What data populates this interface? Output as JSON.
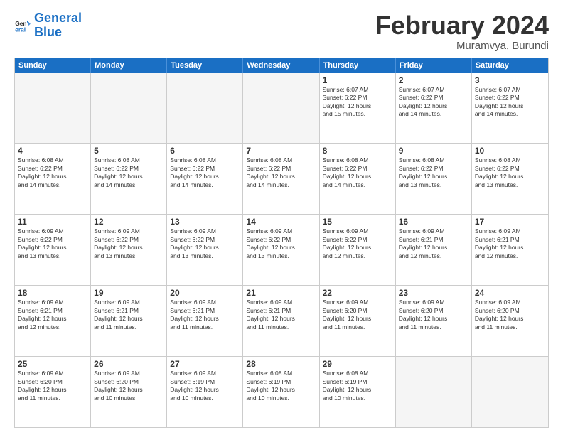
{
  "logo": {
    "line1": "General",
    "line2": "Blue"
  },
  "title": "February 2024",
  "subtitle": "Muramvya, Burundi",
  "header_days": [
    "Sunday",
    "Monday",
    "Tuesday",
    "Wednesday",
    "Thursday",
    "Friday",
    "Saturday"
  ],
  "rows": [
    [
      {
        "day": "",
        "empty": true
      },
      {
        "day": "",
        "empty": true
      },
      {
        "day": "",
        "empty": true
      },
      {
        "day": "",
        "empty": true
      },
      {
        "day": "1",
        "info": "Sunrise: 6:07 AM\nSunset: 6:22 PM\nDaylight: 12 hours\nand 15 minutes."
      },
      {
        "day": "2",
        "info": "Sunrise: 6:07 AM\nSunset: 6:22 PM\nDaylight: 12 hours\nand 14 minutes."
      },
      {
        "day": "3",
        "info": "Sunrise: 6:07 AM\nSunset: 6:22 PM\nDaylight: 12 hours\nand 14 minutes."
      }
    ],
    [
      {
        "day": "4",
        "info": "Sunrise: 6:08 AM\nSunset: 6:22 PM\nDaylight: 12 hours\nand 14 minutes."
      },
      {
        "day": "5",
        "info": "Sunrise: 6:08 AM\nSunset: 6:22 PM\nDaylight: 12 hours\nand 14 minutes."
      },
      {
        "day": "6",
        "info": "Sunrise: 6:08 AM\nSunset: 6:22 PM\nDaylight: 12 hours\nand 14 minutes."
      },
      {
        "day": "7",
        "info": "Sunrise: 6:08 AM\nSunset: 6:22 PM\nDaylight: 12 hours\nand 14 minutes."
      },
      {
        "day": "8",
        "info": "Sunrise: 6:08 AM\nSunset: 6:22 PM\nDaylight: 12 hours\nand 14 minutes."
      },
      {
        "day": "9",
        "info": "Sunrise: 6:08 AM\nSunset: 6:22 PM\nDaylight: 12 hours\nand 13 minutes."
      },
      {
        "day": "10",
        "info": "Sunrise: 6:08 AM\nSunset: 6:22 PM\nDaylight: 12 hours\nand 13 minutes."
      }
    ],
    [
      {
        "day": "11",
        "info": "Sunrise: 6:09 AM\nSunset: 6:22 PM\nDaylight: 12 hours\nand 13 minutes."
      },
      {
        "day": "12",
        "info": "Sunrise: 6:09 AM\nSunset: 6:22 PM\nDaylight: 12 hours\nand 13 minutes."
      },
      {
        "day": "13",
        "info": "Sunrise: 6:09 AM\nSunset: 6:22 PM\nDaylight: 12 hours\nand 13 minutes."
      },
      {
        "day": "14",
        "info": "Sunrise: 6:09 AM\nSunset: 6:22 PM\nDaylight: 12 hours\nand 13 minutes."
      },
      {
        "day": "15",
        "info": "Sunrise: 6:09 AM\nSunset: 6:22 PM\nDaylight: 12 hours\nand 12 minutes."
      },
      {
        "day": "16",
        "info": "Sunrise: 6:09 AM\nSunset: 6:21 PM\nDaylight: 12 hours\nand 12 minutes."
      },
      {
        "day": "17",
        "info": "Sunrise: 6:09 AM\nSunset: 6:21 PM\nDaylight: 12 hours\nand 12 minutes."
      }
    ],
    [
      {
        "day": "18",
        "info": "Sunrise: 6:09 AM\nSunset: 6:21 PM\nDaylight: 12 hours\nand 12 minutes."
      },
      {
        "day": "19",
        "info": "Sunrise: 6:09 AM\nSunset: 6:21 PM\nDaylight: 12 hours\nand 11 minutes."
      },
      {
        "day": "20",
        "info": "Sunrise: 6:09 AM\nSunset: 6:21 PM\nDaylight: 12 hours\nand 11 minutes."
      },
      {
        "day": "21",
        "info": "Sunrise: 6:09 AM\nSunset: 6:21 PM\nDaylight: 12 hours\nand 11 minutes."
      },
      {
        "day": "22",
        "info": "Sunrise: 6:09 AM\nSunset: 6:20 PM\nDaylight: 12 hours\nand 11 minutes."
      },
      {
        "day": "23",
        "info": "Sunrise: 6:09 AM\nSunset: 6:20 PM\nDaylight: 12 hours\nand 11 minutes."
      },
      {
        "day": "24",
        "info": "Sunrise: 6:09 AM\nSunset: 6:20 PM\nDaylight: 12 hours\nand 11 minutes."
      }
    ],
    [
      {
        "day": "25",
        "info": "Sunrise: 6:09 AM\nSunset: 6:20 PM\nDaylight: 12 hours\nand 11 minutes."
      },
      {
        "day": "26",
        "info": "Sunrise: 6:09 AM\nSunset: 6:20 PM\nDaylight: 12 hours\nand 10 minutes."
      },
      {
        "day": "27",
        "info": "Sunrise: 6:09 AM\nSunset: 6:19 PM\nDaylight: 12 hours\nand 10 minutes."
      },
      {
        "day": "28",
        "info": "Sunrise: 6:08 AM\nSunset: 6:19 PM\nDaylight: 12 hours\nand 10 minutes."
      },
      {
        "day": "29",
        "info": "Sunrise: 6:08 AM\nSunset: 6:19 PM\nDaylight: 12 hours\nand 10 minutes."
      },
      {
        "day": "",
        "empty": true
      },
      {
        "day": "",
        "empty": true
      }
    ]
  ]
}
